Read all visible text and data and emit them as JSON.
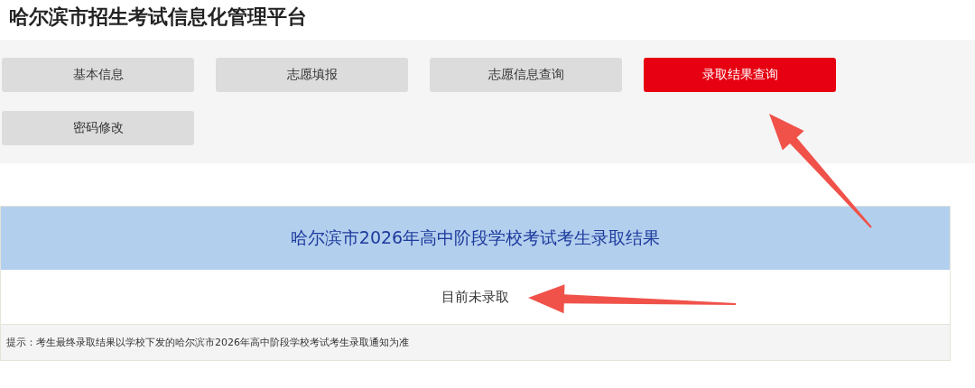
{
  "page_title": "哈尔滨市招生考试信息化管理平台",
  "menu": [
    {
      "label": "基本信息",
      "selected": false
    },
    {
      "label": "志愿填报",
      "selected": false
    },
    {
      "label": "志愿信息查询",
      "selected": false
    },
    {
      "label": "录取结果查询",
      "selected": true
    },
    {
      "label": "密码修改",
      "selected": false
    }
  ],
  "result": {
    "title": "哈尔滨市2026年高中阶段学校考试考生录取结果",
    "status": "目前未录取",
    "note": "提示：考生最终录取结果以学校下发的哈尔滨市2026年高中阶段学校考试考生录取通知为准"
  },
  "annotations": [
    {
      "kind": "arrow"
    },
    {
      "kind": "arrow"
    }
  ]
}
